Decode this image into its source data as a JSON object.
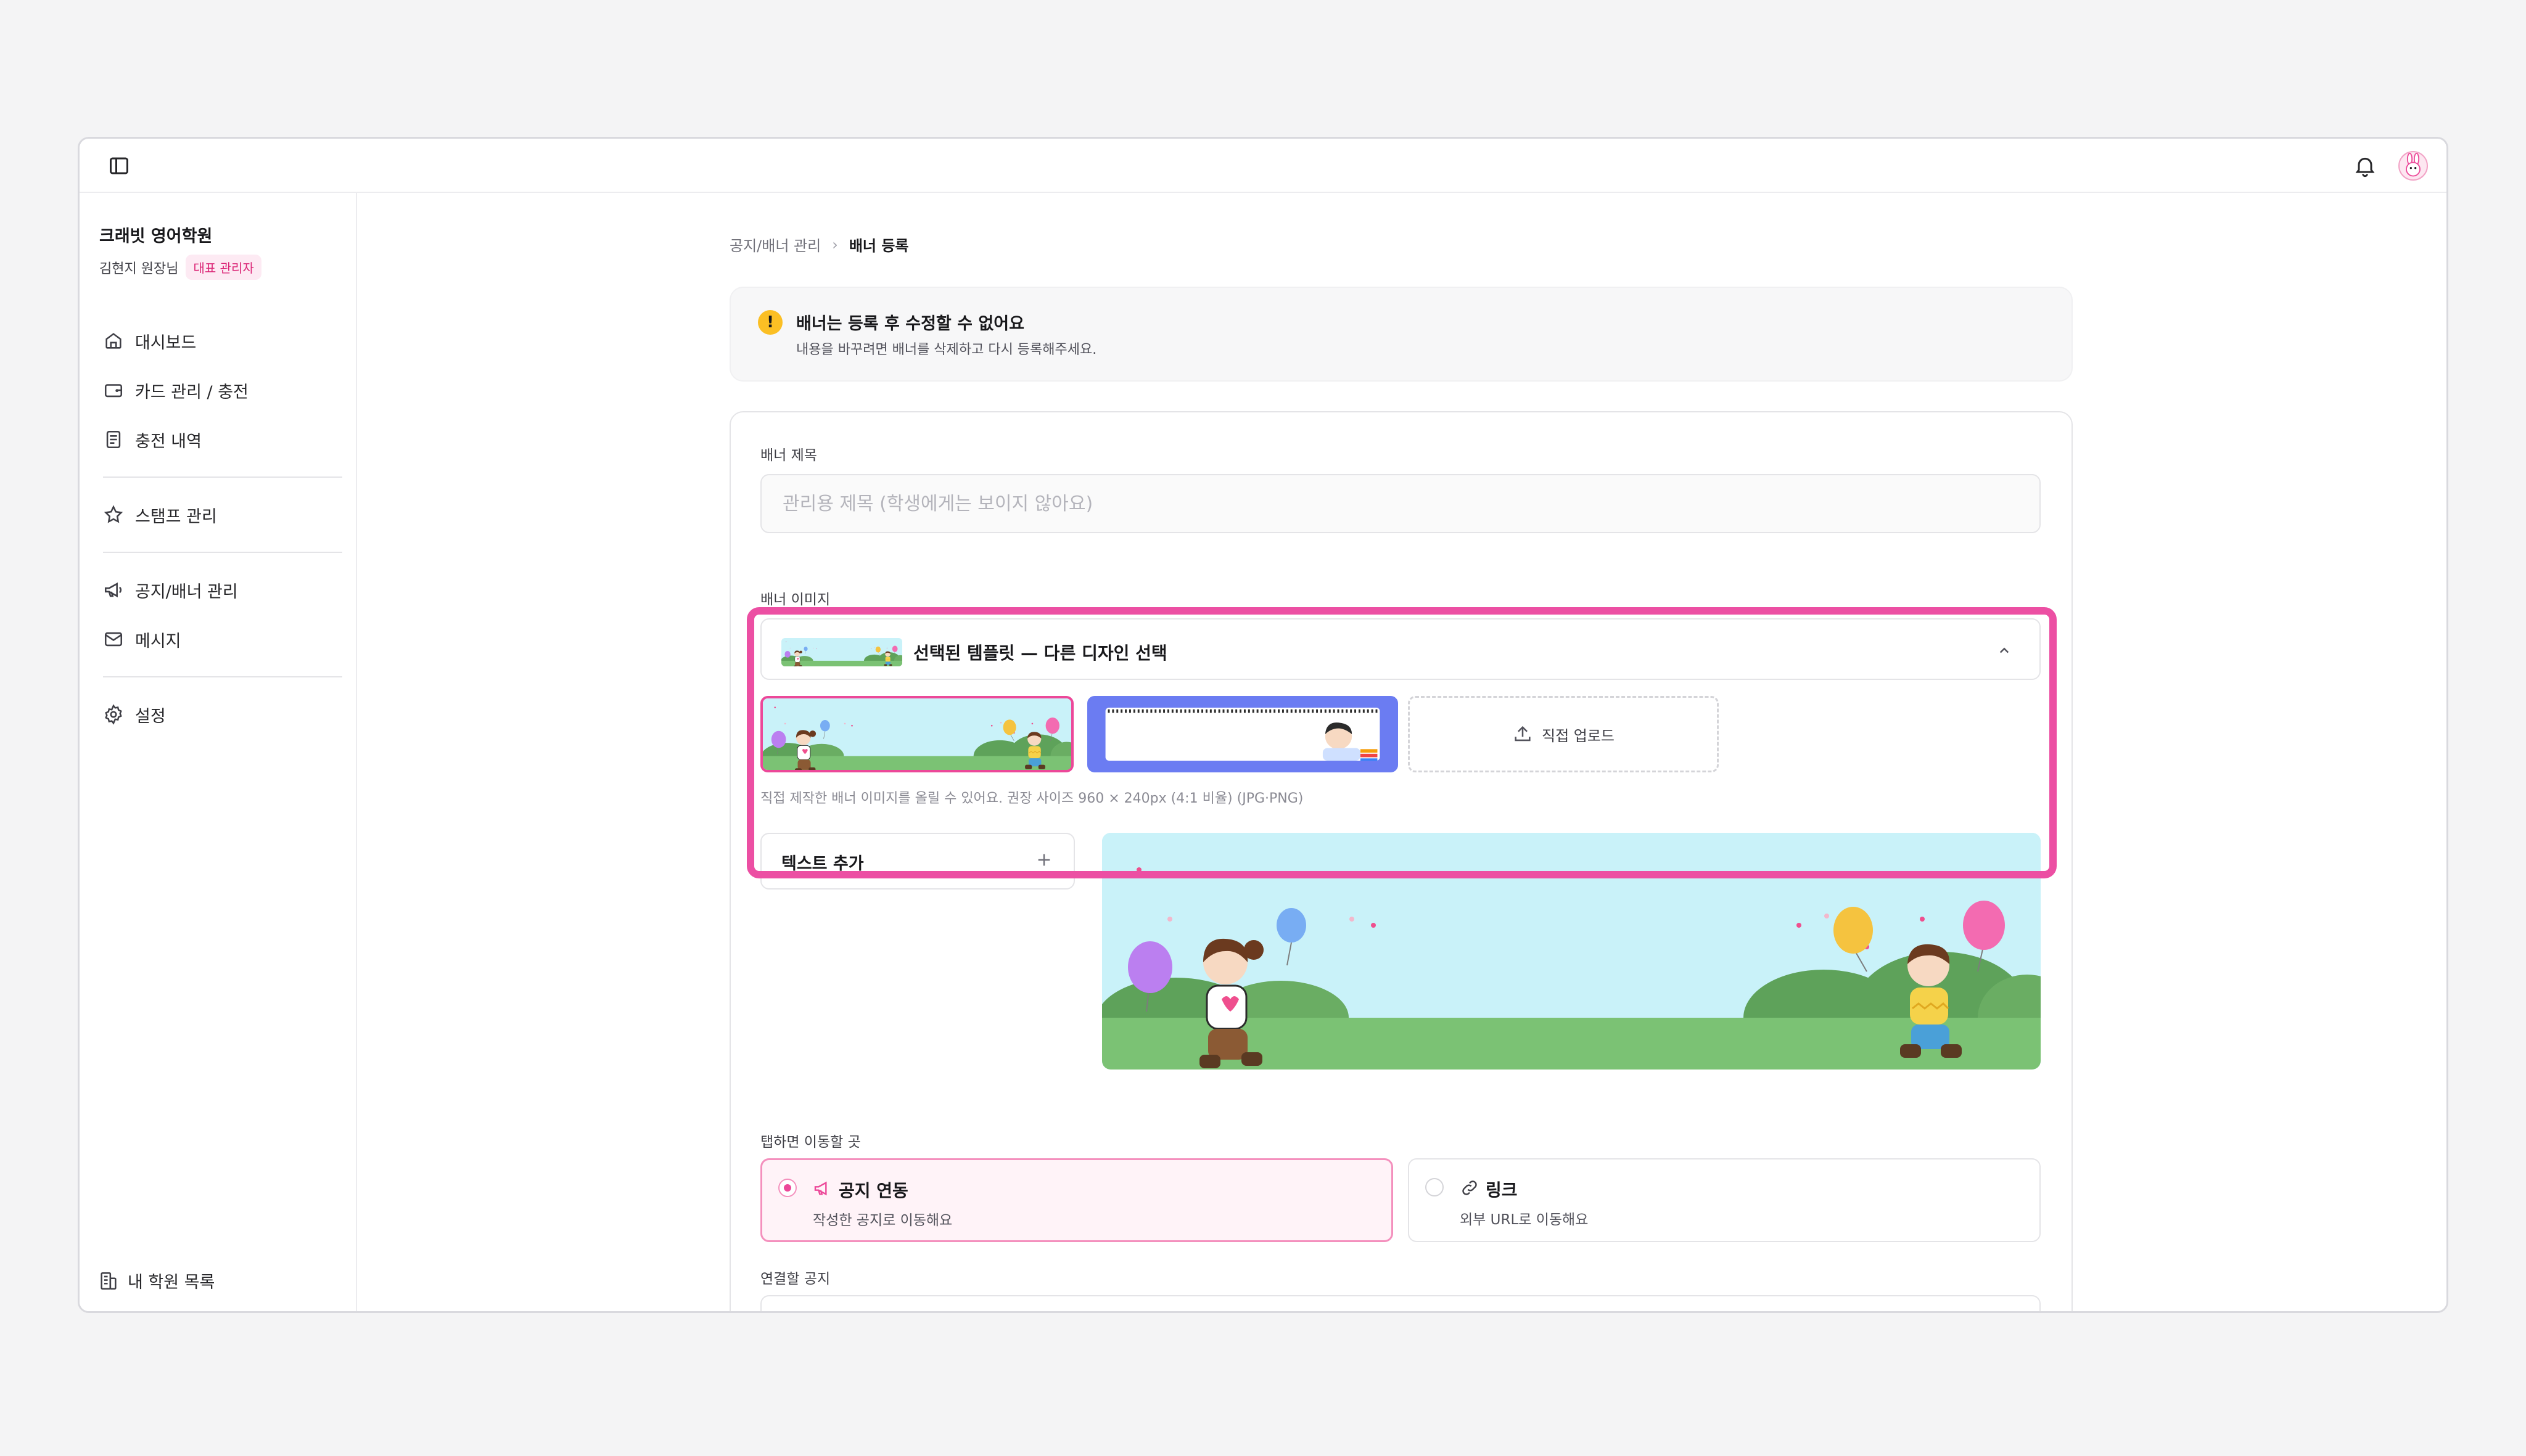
{
  "academy": {
    "name": "크래빗 영어학원",
    "owner": "김현지 원장님",
    "role_badge": "대표 관리자"
  },
  "sidebar": {
    "items": [
      {
        "label": "대시보드",
        "icon": "home-icon"
      },
      {
        "label": "카드 관리 / 충전",
        "icon": "wallet-icon"
      },
      {
        "label": "충전 내역",
        "icon": "receipt-icon"
      },
      {
        "label": "스탬프 관리",
        "icon": "star-icon"
      },
      {
        "label": "공지/배너 관리",
        "icon": "megaphone-icon"
      },
      {
        "label": "메시지",
        "icon": "mail-icon"
      },
      {
        "label": "설정",
        "icon": "gear-icon"
      }
    ],
    "bottom_label": "내 학원 목록"
  },
  "breadcrumb": {
    "parent": "공지/배너 관리",
    "separator": "›",
    "current": "배너 등록"
  },
  "notice": {
    "icon": "!",
    "title": "배너는 등록 후 수정할 수 없어요",
    "description": "내용을 바꾸려면 배너를 삭제하고 다시 등록해주세요."
  },
  "form": {
    "title_label": "배너 제목",
    "title_value": "",
    "title_placeholder": "관리용 제목 (학생에게는 보이지 않아요)",
    "image_label": "배너 이미지",
    "template_selector_label": "선택된 템플릿 — 다른 디자인 선택",
    "upload_label": "직접 업로드",
    "upload_help": "직접 제작한 배너 이미지를 올릴 수 있어요. 권장 사이즈 960 × 240px (4:1 비율) (JPG·PNG)",
    "text_add_label": "텍스트 추가",
    "destination_label": "탭하면 이동할 곳",
    "destinations": [
      {
        "title": "공지 연동",
        "description": "작성한 공지로 이동해요",
        "selected": true,
        "icon": "megaphone-icon"
      },
      {
        "title": "링크",
        "description": "외부 URL로 이동해요",
        "selected": false,
        "icon": "link-icon"
      }
    ],
    "linked_notice_label": "연결할 공지"
  },
  "colors": {
    "accent": "#ec4899",
    "highlight": "#ec4fa3",
    "warning": "#fbbf24",
    "template_blue": "#6b7cf2"
  }
}
